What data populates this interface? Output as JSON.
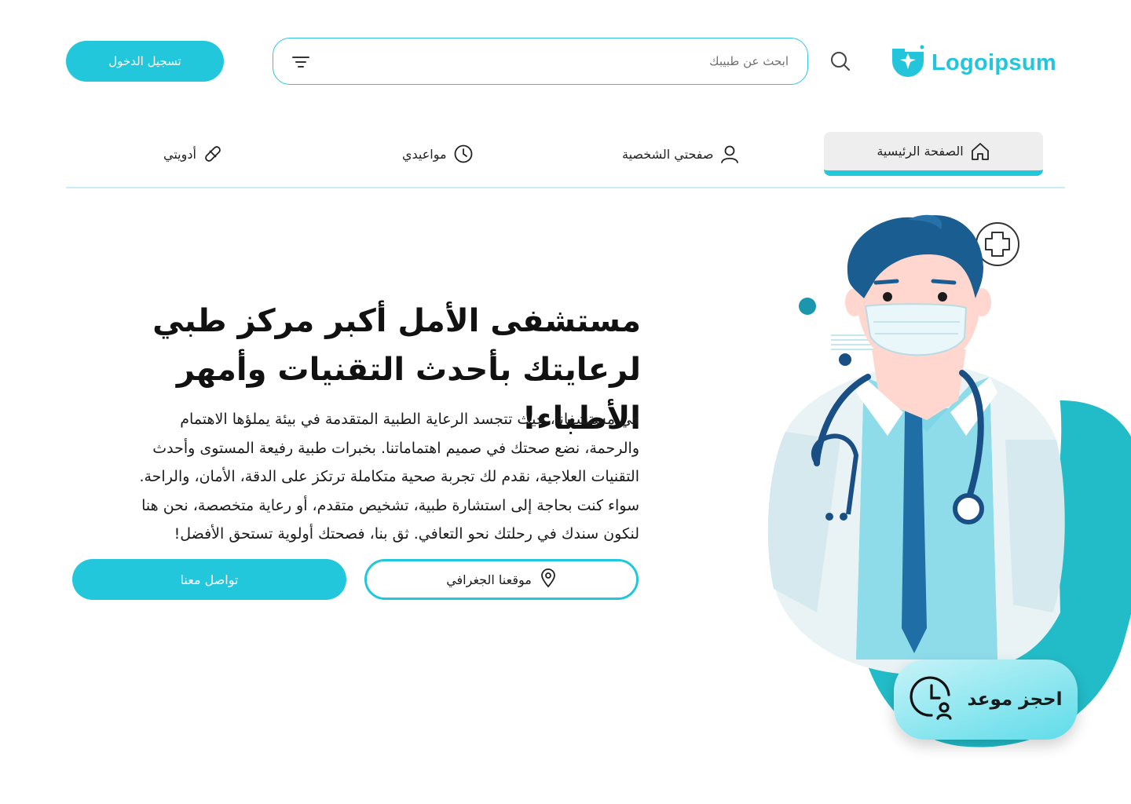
{
  "header": {
    "logo_text": "Logoipsum",
    "search_placeholder": "ابحث عن طبيبك",
    "login_label": "تسجيل الدخول",
    "icons": [
      "logo-mark-icon",
      "search-icon",
      "filter-icon"
    ]
  },
  "nav": {
    "items": [
      {
        "label": "الصفحة الرئيسية",
        "icon": "home-icon",
        "active": true
      },
      {
        "label": "صفحتي الشخصية",
        "icon": "user-icon",
        "active": false
      },
      {
        "label": "مواعيدي",
        "icon": "clock-icon",
        "active": false
      },
      {
        "label": "أدويتي",
        "icon": "pill-icon",
        "active": false
      }
    ]
  },
  "hero": {
    "title_line1": "مستشفى الأمل أكبر مركز طبي",
    "title_line2": "لرعايتك بأحدث التقنيات وأمهر الأطباء!",
    "paragraph_lines": [
      "في مستشفانا، حيث تتجسد الرعاية الطبية المتقدمة في بيئة يملؤها الاهتمام",
      "والرحمة، نضع صحتك في صميم اهتماماتنا. بخبرات طبية رفيعة المستوى وأحدث",
      "التقنيات العلاجية، نقدم لك تجربة صحية متكاملة ترتكز على الدقة، الأمان، والراحة.",
      "سواء كنت بحاجة إلى استشارة طبية، تشخيص متقدم، أو رعاية متخصصة، نحن هنا",
      "لنكون سندك في رحلتك نحو التعافي. ثق بنا، فصحتك أولوية تستحق الأفضل!"
    ],
    "location_label": "موقعنا الجغرافي",
    "contact_label": "تواصل معنا"
  },
  "booking": {
    "label": "احجز موعد",
    "icon": "clock-user-icon"
  },
  "colors": {
    "accent": "#22c7dc",
    "accent_dark": "#1a7fae",
    "text": "#111111"
  }
}
